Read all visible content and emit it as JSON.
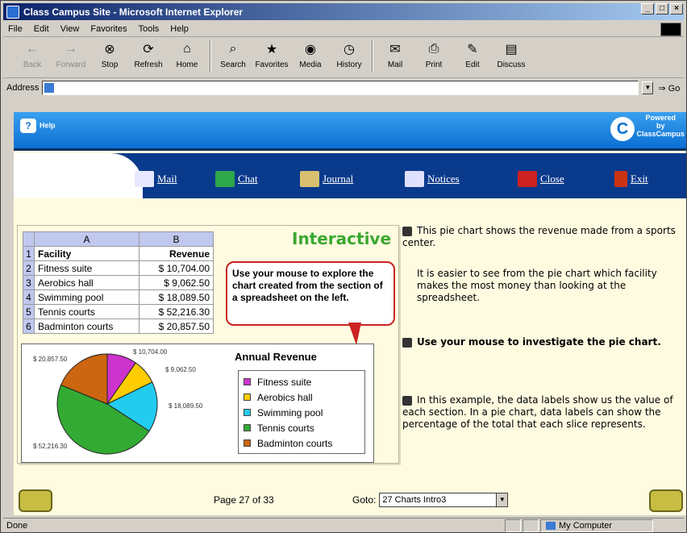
{
  "window": {
    "title": "Class Campus Site - Microsoft Internet Explorer",
    "min": "_",
    "max": "□",
    "close": "×"
  },
  "menu": [
    "File",
    "Edit",
    "View",
    "Favorites",
    "Tools",
    "Help"
  ],
  "toolbar": [
    {
      "label": "Back",
      "icon": "back-arrow-icon",
      "enabled": false
    },
    {
      "label": "Forward",
      "icon": "forward-arrow-icon",
      "enabled": false
    },
    {
      "label": "Stop",
      "icon": "stop-icon",
      "enabled": true
    },
    {
      "label": "Refresh",
      "icon": "refresh-icon",
      "enabled": true
    },
    {
      "label": "Home",
      "icon": "home-icon",
      "enabled": true
    },
    {
      "label": "Search",
      "icon": "search-icon",
      "enabled": true
    },
    {
      "label": "Favorites",
      "icon": "favorites-icon",
      "enabled": true
    },
    {
      "label": "Media",
      "icon": "media-icon",
      "enabled": true
    },
    {
      "label": "History",
      "icon": "history-icon",
      "enabled": true
    },
    {
      "label": "Mail",
      "icon": "mail-icon",
      "enabled": true
    },
    {
      "label": "Print",
      "icon": "print-icon",
      "enabled": true
    },
    {
      "label": "Edit",
      "icon": "edit-icon",
      "enabled": true
    },
    {
      "label": "Discuss",
      "icon": "discuss-icon",
      "enabled": true
    }
  ],
  "address": {
    "label": "Address",
    "value": "",
    "go": "Go"
  },
  "site": {
    "help": "Help",
    "powered": [
      "Powered",
      "by",
      "ClassCampus"
    ],
    "nav": [
      "Mail",
      "Chat",
      "Journal",
      "Notices",
      "Close",
      "Exit"
    ]
  },
  "sheet": {
    "col_headers": [
      "A",
      "B"
    ],
    "rows": [
      {
        "n": "1",
        "a": "Facility",
        "b": "Revenue"
      },
      {
        "n": "2",
        "a": "Fitness suite",
        "b": "$ 10,704.00"
      },
      {
        "n": "3",
        "a": "Aerobics hall",
        "b": "$ 9,062.50"
      },
      {
        "n": "4",
        "a": "Swimming pool",
        "b": "$ 18,089.50"
      },
      {
        "n": "5",
        "a": "Tennis courts",
        "b": "$ 52,216.30"
      },
      {
        "n": "6",
        "a": "Badminton courts",
        "b": "$ 20,857.50"
      }
    ]
  },
  "interactive": "Interactive",
  "callout": "Use your mouse to explore the chart created from the section of a spreadsheet on the left.",
  "chart_data": {
    "type": "pie",
    "title": "Annual Revenue",
    "categories": [
      "Fitness suite",
      "Aerobics hall",
      "Swimming pool",
      "Tennis courts",
      "Badminton courts"
    ],
    "values": [
      10704.0,
      9062.5,
      18089.5,
      52216.3,
      20857.5
    ],
    "data_labels": [
      "$ 10,704.00",
      "$ 9,062.50",
      "$ 18,089.50",
      "$ 52,216.30",
      "$ 20,857.50"
    ],
    "colors": [
      "#cc33cc",
      "#ffcc00",
      "#22ccee",
      "#33aa33",
      "#cc6611"
    ],
    "legend": "right"
  },
  "explain": {
    "p1": "This pie chart shows the revenue made from a sports center.",
    "p2": "It is easier to see from the pie chart which facility makes the most money than looking at the spreadsheet.",
    "p3": "Use your mouse to investigate the pie chart.",
    "p4": "In this example, the data labels show us the value of each section. In a pie chart, data labels can show the percentage of the total that each slice represents."
  },
  "pager": {
    "text": "Page 27 of 33",
    "goto_label": "Goto:",
    "goto_value": "27 Charts Intro3"
  },
  "status": {
    "left": "Done",
    "zone": "My Computer"
  }
}
